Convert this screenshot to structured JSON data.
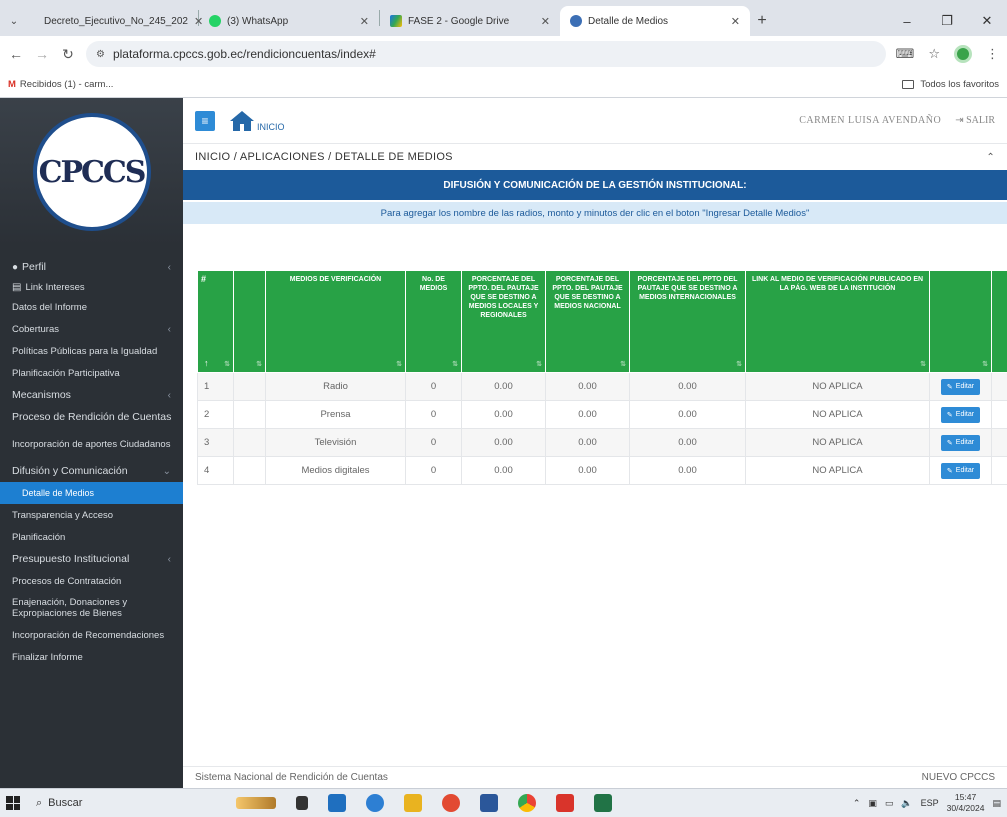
{
  "browser": {
    "tabs": [
      {
        "title": "Decreto_Ejecutivo_No_245_202",
        "active": false,
        "icon": "globe-icon"
      },
      {
        "title": "(3) WhatsApp",
        "active": false,
        "icon": "whatsapp-icon"
      },
      {
        "title": "FASE 2 - Google Drive",
        "active": false,
        "icon": "drive-icon"
      },
      {
        "title": "Detalle de Medios",
        "active": true,
        "icon": "cpccs-icon"
      }
    ],
    "url": "plataforma.cpccs.gob.ec/rendicioncuentas/index#",
    "bookmark": "Recibidos (1) - carm...",
    "all_bookmarks": "Todos los favoritos"
  },
  "sidebar": {
    "logo_text": "CPCCS",
    "items": [
      {
        "label": "Perfil",
        "chevron": true
      },
      {
        "label": "Link Intereses"
      },
      {
        "label": "Datos del Informe"
      },
      {
        "label": "Coberturas",
        "chevron": true
      },
      {
        "label": "Políticas Públicas para la Igualdad"
      },
      {
        "label": "Planificación Participativa"
      },
      {
        "label": "Mecanismos",
        "chevron": true
      },
      {
        "label": "Proceso de Rendición de Cuentas"
      },
      {
        "label": "Incorporación de aportes Ciudadanos"
      },
      {
        "label": "Difusión y Comunicación",
        "chevron": true
      },
      {
        "label": "Detalle de Medios"
      },
      {
        "label": "Transparencia y Acceso"
      },
      {
        "label": "Planificación"
      },
      {
        "label": "Presupuesto Institucional",
        "chevron": true
      },
      {
        "label": "Procesos de Contratación"
      },
      {
        "label": "Enajenación, Donaciones y Expropiaciones de Bienes"
      },
      {
        "label": "Incorporación de Recomendaciones"
      },
      {
        "label": "Finalizar Informe"
      }
    ]
  },
  "topbar": {
    "home_label": "INICIO",
    "user_name": "CARMEN LUISA AVENDAÑO",
    "logout_label": "SALIR"
  },
  "breadcrumb": "INICIO / APLICACIONES / DETALLE DE MEDIOS",
  "banner": "DIFUSIÓN Y COMUNICACIÓN DE LA GESTIÓN INSTITUCIONAL:",
  "info": "Para agregar los nombre de las radios, monto y minutos der clic en el boton \"Ingresar Detalle Medios\"",
  "table": {
    "headers": [
      "#",
      "",
      "MEDIOS DE VERIFICACIÓN",
      "No. DE MEDIOS",
      "PORCENTAJE DEL PPTO. DEL PAUTAJE QUE SE DESTINO A MEDIOS LOCALES Y REGIONALES",
      "PORCENTAJE DEL PPTO. DEL PAUTAJE QUE SE DESTINO A MEDIOS NACIONAL",
      "PORCENTAJE DEL PPTO DEL PAUTAJE QUE SE DESTINO A MEDIOS INTERNACIONALES",
      "LINK AL MEDIO DE VERIFICACIÓN PUBLICADO EN LA PÁG. WEB DE LA INSTITUCIÓN",
      "",
      ""
    ],
    "rows": [
      {
        "n": "1",
        "medio": "Radio",
        "num": "0",
        "loc": "0.00",
        "nac": "0.00",
        "int": "0.00",
        "link": "NO APLICA",
        "edit": "Editar"
      },
      {
        "n": "2",
        "medio": "Prensa",
        "num": "0",
        "loc": "0.00",
        "nac": "0.00",
        "int": "0.00",
        "link": "NO APLICA",
        "edit": "Editar"
      },
      {
        "n": "3",
        "medio": "Televisión",
        "num": "0",
        "loc": "0.00",
        "nac": "0.00",
        "int": "0.00",
        "link": "NO APLICA",
        "edit": "Editar"
      },
      {
        "n": "4",
        "medio": "Medios digitales",
        "num": "0",
        "loc": "0.00",
        "nac": "0.00",
        "int": "0.00",
        "link": "NO APLICA",
        "edit": "Editar"
      }
    ]
  },
  "footer": {
    "left": "Sistema Nacional de Rendición de Cuentas",
    "right": "NUEVO CPCCS"
  },
  "taskbar": {
    "search": "Buscar",
    "lang": "ESP",
    "time": "15:47",
    "date": "30/4/2024"
  }
}
